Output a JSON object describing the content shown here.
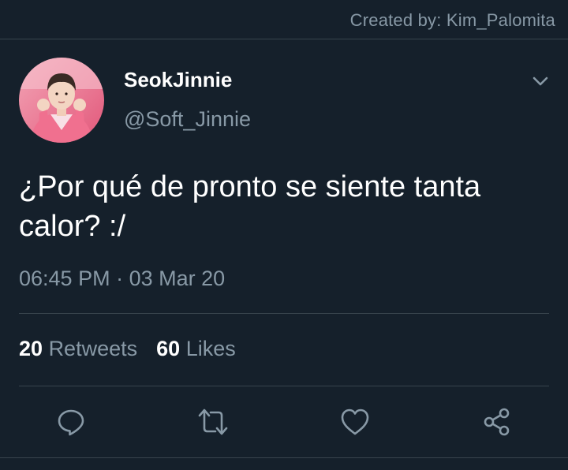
{
  "watermark": {
    "text": "Created by: Kim_Palomita"
  },
  "user": {
    "display_name": "SeokJinnie",
    "handle": "@Soft_Jinnie",
    "avatar_icon": "profile-photo"
  },
  "tweet": {
    "text_line1": "¿Por qué de pronto se siente tanta",
    "text_line2": "calor? :/",
    "time": "06:45 PM",
    "separator": " · ",
    "date": "03 Mar 20"
  },
  "stats": {
    "retweets_count": "20",
    "retweets_label": "Retweets",
    "likes_count": "60",
    "likes_label": "Likes"
  },
  "actions": [
    {
      "name": "reply",
      "icon": "comment-icon"
    },
    {
      "name": "retweet",
      "icon": "retweet-icon"
    },
    {
      "name": "like",
      "icon": "heart-icon"
    },
    {
      "name": "share",
      "icon": "share-icon"
    }
  ],
  "colors": {
    "background": "#15202b",
    "divider": "#38444d",
    "secondary_text": "#8899a6",
    "primary_text": "#ffffff"
  }
}
